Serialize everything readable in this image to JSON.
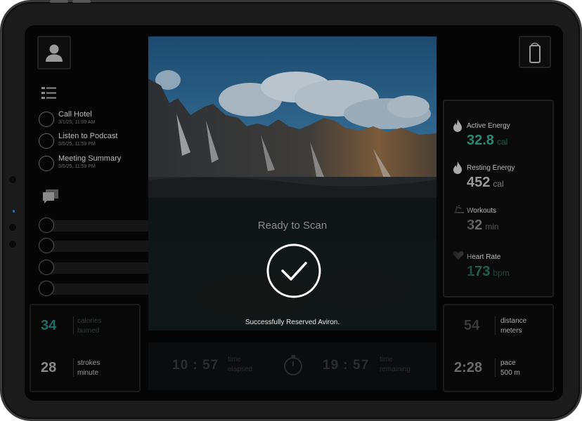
{
  "tasks": [
    {
      "title": "Call Hotel",
      "date": "3/1/25, 11:00 AM"
    },
    {
      "title": "Listen to Podcast",
      "date": "3/5/25, 11:59 PM"
    },
    {
      "title": "Meeting Summary",
      "date": "3/5/25, 11:59 PM"
    }
  ],
  "left_stats": [
    {
      "value": "34",
      "label_line1": "calories",
      "label_line2": "burned",
      "color": "#1f6e63"
    },
    {
      "value": "28",
      "label_line1": "strokes",
      "label_line2": "minute",
      "color": "#8a8a8a"
    }
  ],
  "right_stats": [
    {
      "value": "54",
      "label_line1": "distance",
      "label_line2": "meters",
      "color": "#3a3a3a"
    },
    {
      "value": "2:28",
      "label_line1": "pace",
      "label_line2": "500 m",
      "color": "#6a6a6a"
    }
  ],
  "modal": {
    "title": "Ready to Scan",
    "message": "Successfully Reserved Aviron."
  },
  "timer": {
    "elapsed_value": "10 : 57",
    "elapsed_label_line1": "time",
    "elapsed_label_line2": "elapsed",
    "remaining_value": "19 : 57",
    "remaining_label_line1": "time",
    "remaining_label_line2": "remaining"
  },
  "metrics": [
    {
      "label": "Active Energy",
      "value": "32.8",
      "unit": "cal",
      "icon": "flame-icon",
      "color": "#2a8a78"
    },
    {
      "label": "Resting Energy",
      "value": "452",
      "unit": "cal",
      "icon": "flame-icon",
      "color": "#9a9a9a"
    },
    {
      "label": "Workouts",
      "value": "32",
      "unit": "min",
      "icon": "workout-icon",
      "color": "#6a6a6a"
    },
    {
      "label": "Heart Rate",
      "value": "173",
      "unit": "bpm",
      "icon": "heart-rate-icon",
      "color": "#1f5e55"
    }
  ],
  "colors": {
    "accent_teal": "#2a8a78",
    "background": "#050505"
  }
}
